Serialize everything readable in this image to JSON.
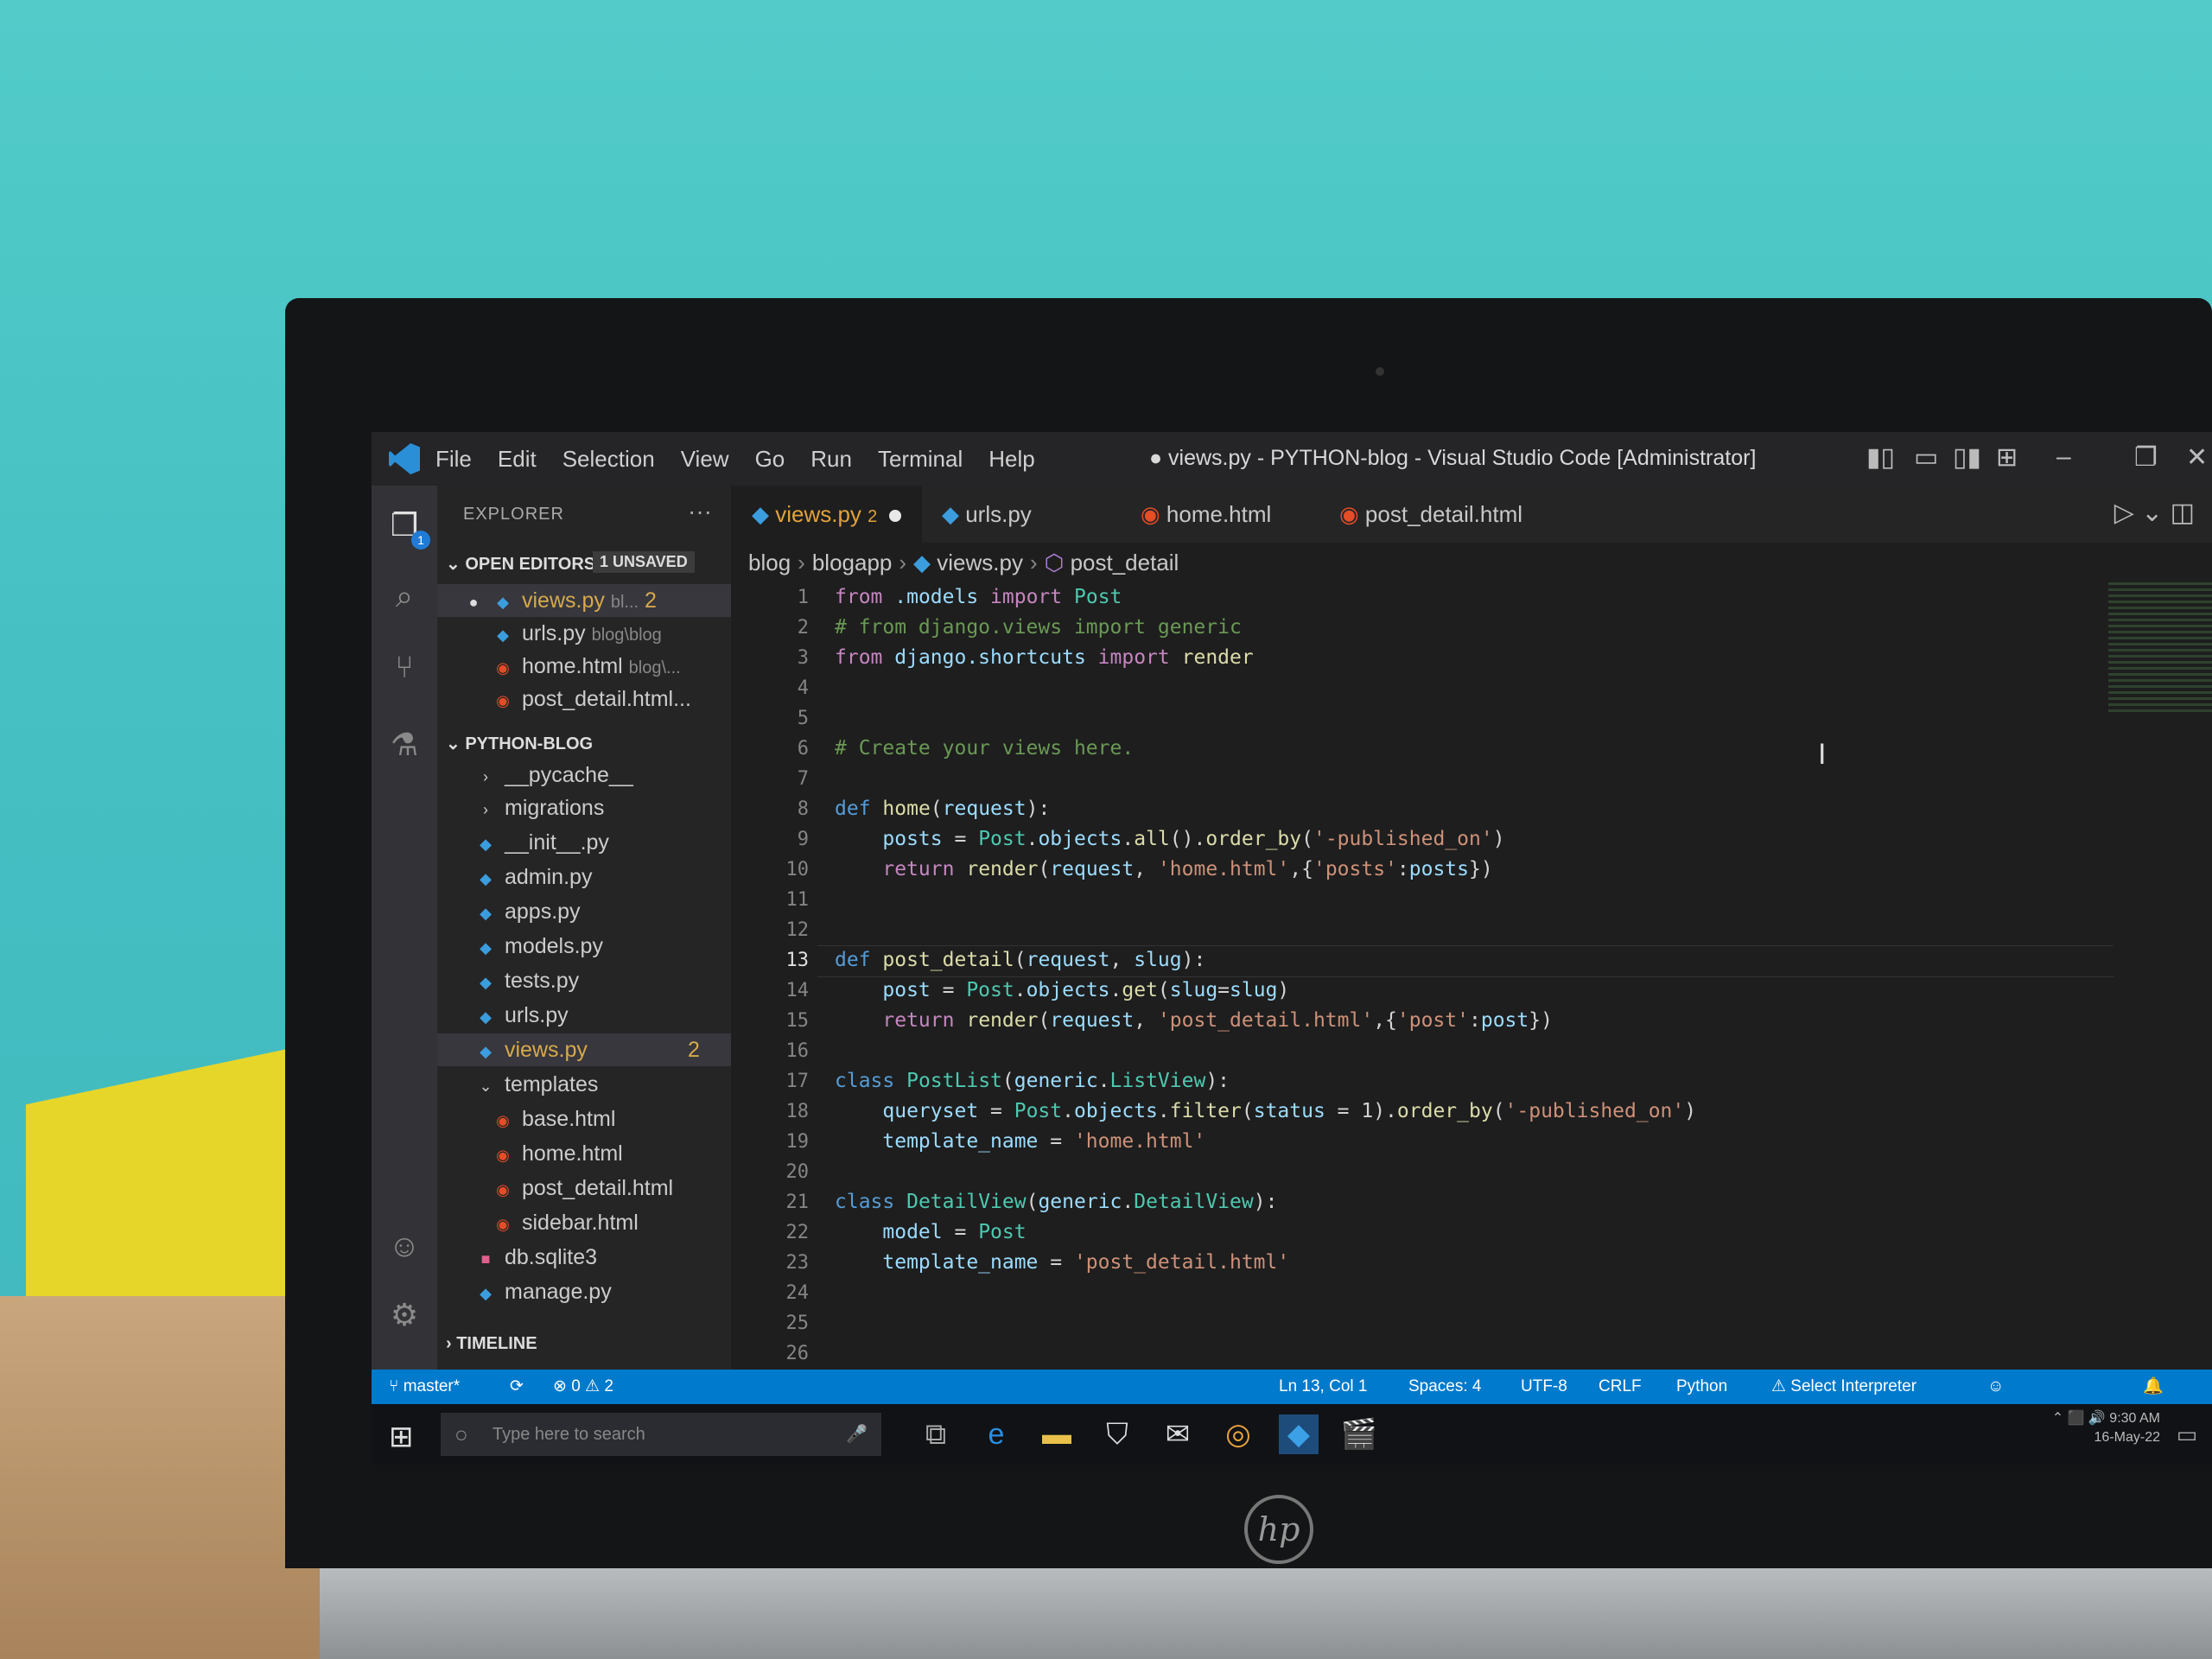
{
  "window": {
    "title": "● views.py - PYTHON-blog - Visual Studio Code [Administrator]",
    "menu": [
      "File",
      "Edit",
      "Selection",
      "View",
      "Go",
      "Run",
      "Terminal",
      "Help"
    ]
  },
  "sidebar": {
    "title": "EXPLORER",
    "more": "···",
    "open_editors_label": "OPEN EDITORS",
    "unsaved_badge": "1 UNSAVED",
    "open_editors": [
      {
        "name": "views.py",
        "hint": "bl...",
        "count": "2"
      },
      {
        "name": "urls.py",
        "hint": "blog\\blog"
      },
      {
        "name": "home.html",
        "hint": "blog\\..."
      },
      {
        "name": "post_detail.html..."
      }
    ],
    "project_label": "PYTHON-BLOG",
    "tree": [
      {
        "name": "__pycache__"
      },
      {
        "name": "migrations"
      },
      {
        "name": "__init__.py"
      },
      {
        "name": "admin.py"
      },
      {
        "name": "apps.py"
      },
      {
        "name": "models.py"
      },
      {
        "name": "tests.py"
      },
      {
        "name": "urls.py"
      },
      {
        "name": "views.py",
        "count": "2"
      },
      {
        "name": "templates"
      },
      {
        "name": "base.html"
      },
      {
        "name": "home.html"
      },
      {
        "name": "post_detail.html"
      },
      {
        "name": "sidebar.html"
      },
      {
        "name": "db.sqlite3"
      },
      {
        "name": "manage.py"
      }
    ],
    "timeline_label": "TIMELINE"
  },
  "tabs": [
    {
      "label": "views.py",
      "count": "2"
    },
    {
      "label": "urls.py"
    },
    {
      "label": "home.html"
    },
    {
      "label": "post_detail.html"
    }
  ],
  "breadcrumb": [
    "blog",
    "blogapp",
    "views.py",
    "post_detail"
  ],
  "editor": {
    "line_numbers": [
      "1",
      "2",
      "3",
      "4",
      "5",
      "6",
      "7",
      "8",
      "9",
      "10",
      "11",
      "12",
      "13",
      "14",
      "15",
      "16",
      "17",
      "18",
      "19",
      "20",
      "21",
      "22",
      "23",
      "24",
      "25",
      "26"
    ],
    "current_line": "13"
  },
  "status": {
    "branch": "master*",
    "problems": "⊗ 0 ⚠ 2",
    "position": "Ln 13, Col 1",
    "spaces": "Spaces: 4",
    "encoding": "UTF-8",
    "eol": "CRLF",
    "language": "Python",
    "interpreter": "⚠ Select Interpreter"
  },
  "taskbar": {
    "search_placeholder": "Type here to search",
    "time": "9:30 AM",
    "date": "16-May-22"
  },
  "colors": {
    "status_bar": "#007acc",
    "editor_bg": "#1e1e1e",
    "modified": "#e2a23a"
  }
}
